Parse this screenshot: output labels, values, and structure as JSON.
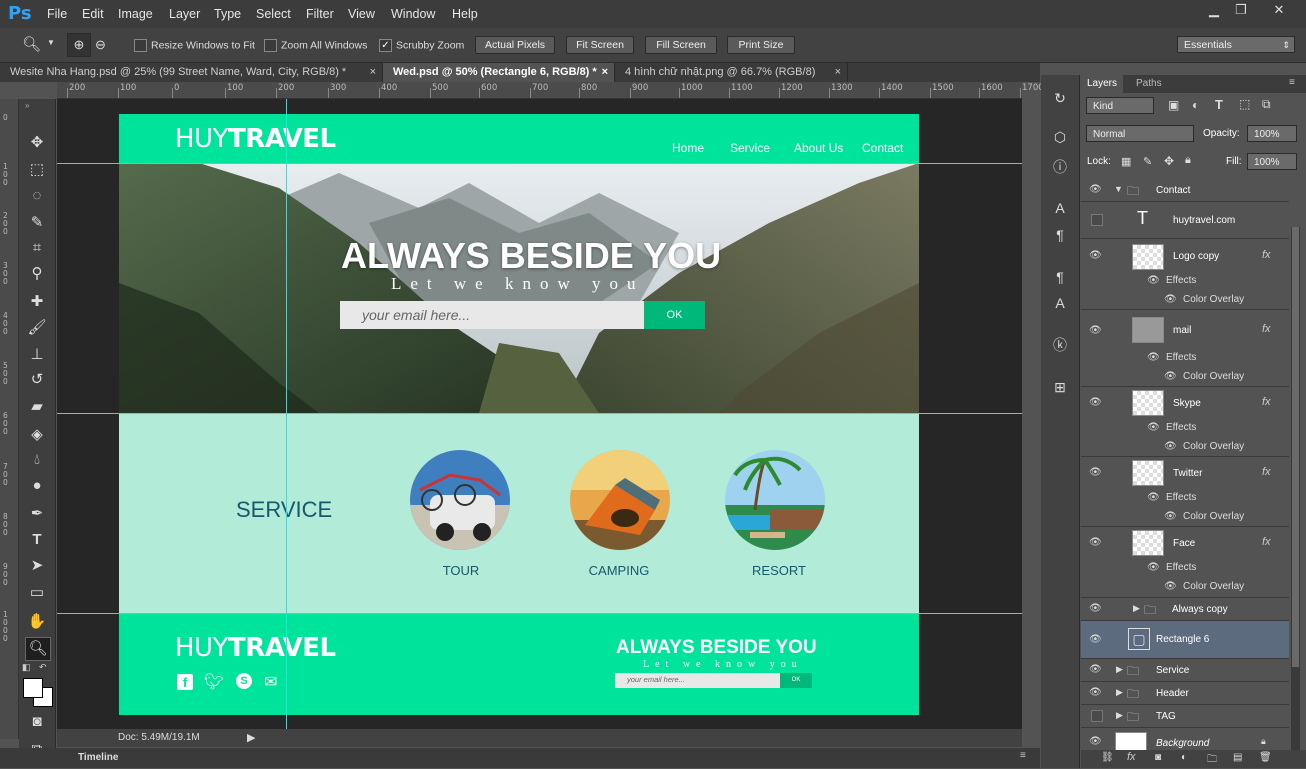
{
  "app": {
    "logo": "Ps"
  },
  "menu": [
    "File",
    "Edit",
    "Image",
    "Layer",
    "Type",
    "Select",
    "Filter",
    "View",
    "Window",
    "Help"
  ],
  "window_controls": {
    "minimize": "▁",
    "restore": "❐",
    "close": "✕"
  },
  "options": {
    "resize_windows": "Resize Windows to Fit",
    "zoom_all": "Zoom All Windows",
    "scrubby": "Scrubby Zoom",
    "actual_pixels": "Actual Pixels",
    "fit_screen": "Fit Screen",
    "fill_screen": "Fill Screen",
    "print_size": "Print Size",
    "workspace": "Essentials"
  },
  "tabs": [
    "Wesite Nha Hang.psd @ 25% (99 Street Name, Ward, City, RGB/8) *",
    "Wed.psd @ 50% (Rectangle 6, RGB/8) *",
    "4 hình chữ nhật.png @ 66.7% (RGB/8)"
  ],
  "ruler_h": [
    "200",
    "100",
    "0",
    "100",
    "200",
    "300",
    "400",
    "500",
    "600",
    "700",
    "800",
    "900",
    "1000",
    "1100",
    "1200",
    "1300",
    "1400",
    "1500",
    "1600",
    "1700"
  ],
  "ruler_v": [
    "0",
    "1 0 0",
    "2 0 0",
    "3 0 0",
    "4 0 0",
    "5 0 0",
    "6 0 0",
    "7 0 0",
    "8 0 0",
    "9 0 0",
    "1 0 0 0"
  ],
  "site": {
    "logo_light": "HUY",
    "logo_bold": "TRAVEL",
    "nav": [
      "Home",
      "Service",
      "About Us",
      "Contact"
    ],
    "hero_title": "ALWAYS BESIDE YOU",
    "hero_subtitle": "Let we know you",
    "email_placeholder": "your email here...",
    "ok": "OK",
    "service_heading": "SERVICE",
    "services": [
      "TOUR",
      "CAMPING",
      "RESORT"
    ],
    "footer_title": "ALWAYS BESIDE YOU",
    "footer_subtitle": "Let we know you",
    "footer_placeholder": "your email here...",
    "footer_ok": "OK"
  },
  "status": {
    "doc": "Doc: 5.49M/19.1M"
  },
  "bottom": {
    "timeline": "Timeline"
  },
  "layers_panel": {
    "tabs": [
      "Layers",
      "Paths"
    ],
    "filter": "Kind",
    "blend": "Normal",
    "opacity_label": "Opacity:",
    "opacity": "100%",
    "lock_label": "Lock:",
    "fill_label": "Fill:",
    "fill": "100%",
    "effects_label": "Effects",
    "overlay_label": "Color Overlay",
    "fx": "fx",
    "layers": {
      "contact": "Contact",
      "text": "huytravel.com",
      "logo_copy": "Logo copy",
      "mail": "mail",
      "skype": "Skype",
      "twitter": "Twitter",
      "face": "Face",
      "always_copy": "Always copy",
      "rect6": "Rectangle 6",
      "service": "Service",
      "header": "Header",
      "tag": "TAG",
      "background": "Background"
    }
  }
}
